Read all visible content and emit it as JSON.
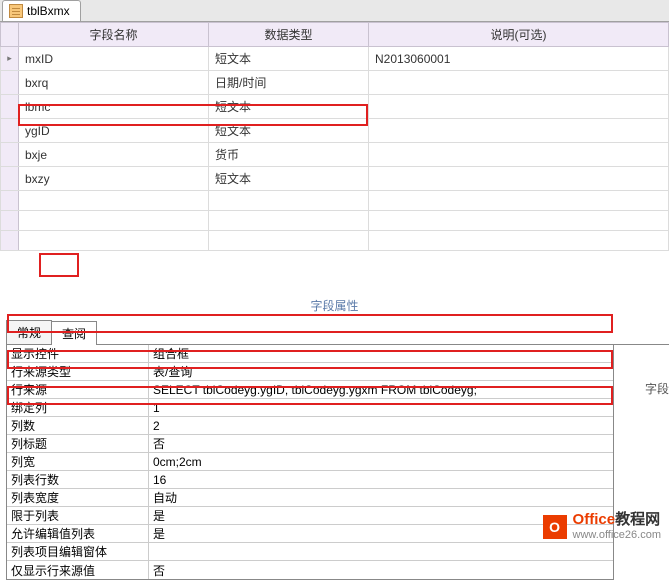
{
  "tab": {
    "title": "tblBxmx"
  },
  "grid": {
    "headers": {
      "name": "字段名称",
      "type": "数据类型",
      "desc": "说明(可选)"
    },
    "rows": [
      {
        "name": "mxID",
        "type": "短文本",
        "desc": "N2013060001"
      },
      {
        "name": "bxrq",
        "type": "日期/时间",
        "desc": ""
      },
      {
        "name": "lbmc",
        "type": "短文本",
        "desc": ""
      },
      {
        "name": "ygID",
        "type": "短文本",
        "desc": ""
      },
      {
        "name": "bxje",
        "type": "货币",
        "desc": ""
      },
      {
        "name": "bxzy",
        "type": "短文本",
        "desc": ""
      }
    ]
  },
  "fieldPropsLabel": "字段属性",
  "propTabs": {
    "general": "常规",
    "lookup": "查阅"
  },
  "props": [
    {
      "label": "显示控件",
      "val": "组合框"
    },
    {
      "label": "行来源类型",
      "val": "表/查询"
    },
    {
      "label": "行来源",
      "val": "SELECT tblCodeyg.ygID, tblCodeyg.ygxm FROM tblCodeyg;"
    },
    {
      "label": "绑定列",
      "val": "1"
    },
    {
      "label": "列数",
      "val": "2"
    },
    {
      "label": "列标题",
      "val": "否"
    },
    {
      "label": "列宽",
      "val": "0cm;2cm"
    },
    {
      "label": "列表行数",
      "val": "16"
    },
    {
      "label": "列表宽度",
      "val": "自动"
    },
    {
      "label": "限于列表",
      "val": "是"
    },
    {
      "label": "允许编辑值列表",
      "val": "是"
    },
    {
      "label": "列表项目编辑窗体",
      "val": ""
    },
    {
      "label": "仅显示行来源值",
      "val": "否"
    }
  ],
  "sideLabel": "字段",
  "watermark": {
    "brand": "Office",
    "suffix": "教程网",
    "url": "www.office26.com",
    "icon": "O"
  }
}
